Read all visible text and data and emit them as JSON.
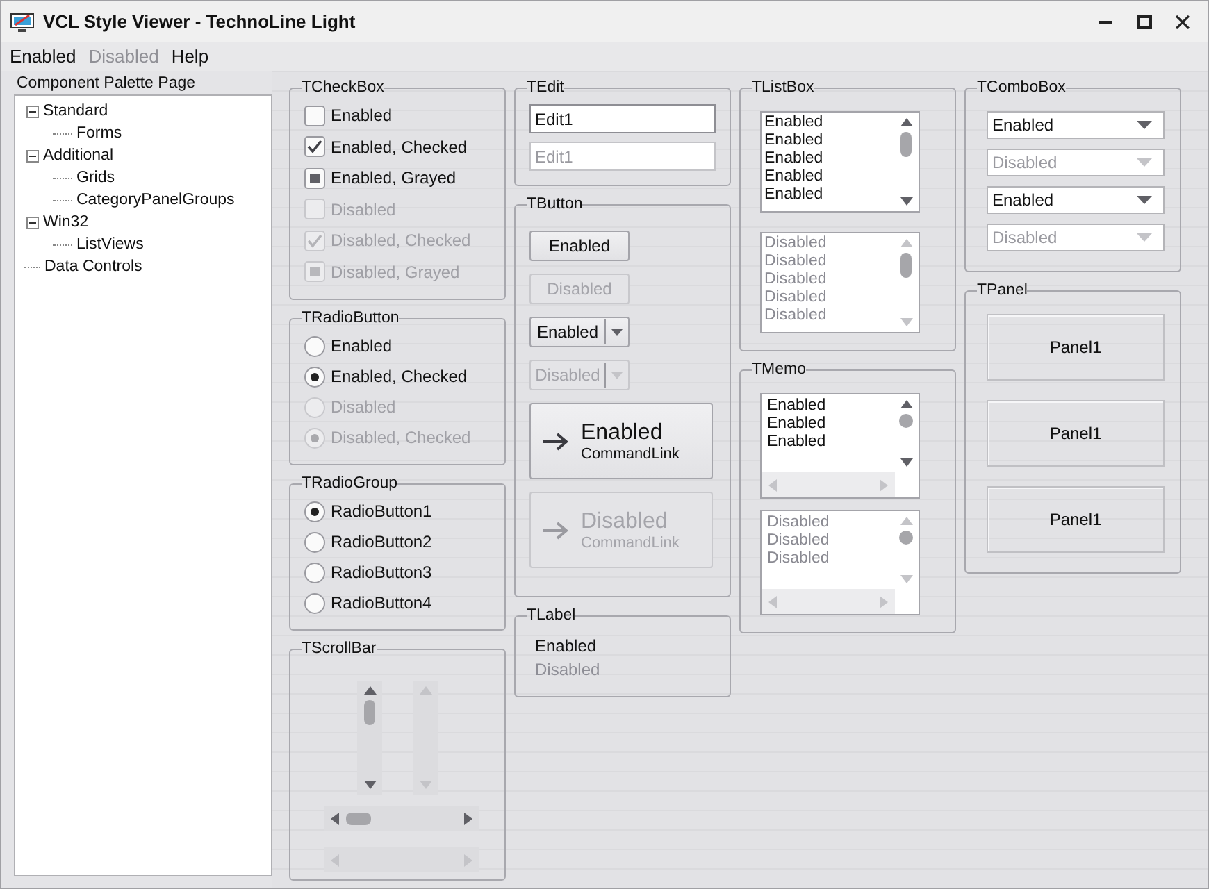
{
  "window": {
    "title": "VCL Style Viewer - TechnoLine Light"
  },
  "menu": [
    {
      "label": "Enabled",
      "disabled": false
    },
    {
      "label": "Disabled",
      "disabled": true
    },
    {
      "label": "Help",
      "disabled": false
    }
  ],
  "palette": {
    "title": "Component Palette Page",
    "tree": [
      {
        "label": "Standard",
        "expanded": true,
        "children": [
          {
            "label": "Forms"
          }
        ]
      },
      {
        "label": "Additional",
        "expanded": true,
        "children": [
          {
            "label": "Grids"
          },
          {
            "label": "CategoryPanelGroups"
          }
        ]
      },
      {
        "label": "Win32",
        "expanded": true,
        "children": [
          {
            "label": "ListViews"
          }
        ]
      },
      {
        "label": "Data Controls"
      }
    ]
  },
  "columns": [
    {
      "groups": [
        {
          "title": "TCheckBox",
          "kind": "checkbox",
          "items": [
            {
              "label": "Enabled",
              "checked": false,
              "grayed": false,
              "disabled": false
            },
            {
              "label": "Enabled, Checked",
              "checked": true,
              "grayed": false,
              "disabled": false
            },
            {
              "label": "Enabled, Grayed",
              "checked": false,
              "grayed": true,
              "disabled": false
            },
            {
              "label": "Disabled",
              "checked": false,
              "grayed": false,
              "disabled": true
            },
            {
              "label": "Disabled, Checked",
              "checked": true,
              "grayed": false,
              "disabled": true
            },
            {
              "label": "Disabled, Grayed",
              "checked": false,
              "grayed": true,
              "disabled": true
            }
          ]
        },
        {
          "title": "TRadioButton",
          "kind": "radio",
          "items": [
            {
              "label": "Enabled",
              "checked": false,
              "disabled": false
            },
            {
              "label": "Enabled, Checked",
              "checked": true,
              "disabled": false
            },
            {
              "label": "Disabled",
              "checked": false,
              "disabled": true
            },
            {
              "label": "Disabled, Checked",
              "checked": true,
              "disabled": true
            }
          ]
        },
        {
          "title": "TRadioGroup",
          "kind": "radio",
          "items": [
            {
              "label": "RadioButton1",
              "checked": true,
              "disabled": false
            },
            {
              "label": "RadioButton2",
              "checked": false,
              "disabled": false
            },
            {
              "label": "RadioButton3",
              "checked": false,
              "disabled": false
            },
            {
              "label": "RadioButton4",
              "checked": false,
              "disabled": false
            }
          ]
        },
        {
          "title": "TScrollBar",
          "kind": "scrollbar",
          "items": [
            {
              "kind": "vertical",
              "disabled": false
            },
            {
              "kind": "vertical",
              "disabled": true
            },
            {
              "kind": "horizontal",
              "disabled": false
            },
            {
              "kind": "horizontal",
              "disabled": true
            }
          ]
        }
      ]
    },
    {
      "groups": [
        {
          "title": "TEdit",
          "kind": "edit",
          "items": [
            {
              "value": "Edit1",
              "disabled": false
            },
            {
              "value": "Edit1",
              "disabled": true
            }
          ]
        },
        {
          "title": "TButton",
          "kind": "button",
          "items": [
            {
              "kind": "push",
              "label": "Enabled",
              "disabled": false
            },
            {
              "kind": "push",
              "label": "Disabled",
              "disabled": true
            },
            {
              "kind": "split",
              "label": "Enabled",
              "disabled": false
            },
            {
              "kind": "split",
              "label": "Disabled",
              "disabled": true
            },
            {
              "kind": "commandlink",
              "label": "Enabled",
              "note": "CommandLink",
              "disabled": false
            },
            {
              "kind": "commandlink",
              "label": "Disabled",
              "note": "CommandLink",
              "disabled": true
            }
          ]
        },
        {
          "title": "TLabel",
          "kind": "label",
          "items": [
            {
              "text": "Enabled",
              "disabled": false
            },
            {
              "text": "Disabled",
              "disabled": true
            }
          ]
        }
      ]
    },
    {
      "groups": [
        {
          "title": "TListBox",
          "kind": "listbox",
          "items": [
            {
              "lines": [
                "Enabled",
                "Enabled",
                "Enabled",
                "Enabled",
                "Enabled"
              ],
              "disabled": false
            },
            {
              "lines": [
                "Disabled",
                "Disabled",
                "Disabled",
                "Disabled",
                "Disabled"
              ],
              "disabled": true
            }
          ]
        },
        {
          "title": "TMemo",
          "kind": "memo",
          "items": [
            {
              "lines": [
                "Enabled",
                "Enabled",
                "Enabled"
              ],
              "disabled": false
            },
            {
              "lines": [
                "Disabled",
                "Disabled",
                "Disabled"
              ],
              "disabled": true
            }
          ]
        }
      ]
    },
    {
      "groups": [
        {
          "title": "TComboBox",
          "kind": "combobox",
          "items": [
            {
              "value": "Enabled",
              "disabled": false
            },
            {
              "value": "Disabled",
              "disabled": true
            },
            {
              "value": "Enabled",
              "disabled": false
            },
            {
              "value": "Disabled",
              "disabled": true
            }
          ]
        },
        {
          "title": "TPanel",
          "kind": "panel",
          "items": [
            {
              "caption": "Panel1"
            },
            {
              "caption": "Panel1"
            },
            {
              "caption": "Panel1"
            }
          ]
        }
      ]
    }
  ]
}
